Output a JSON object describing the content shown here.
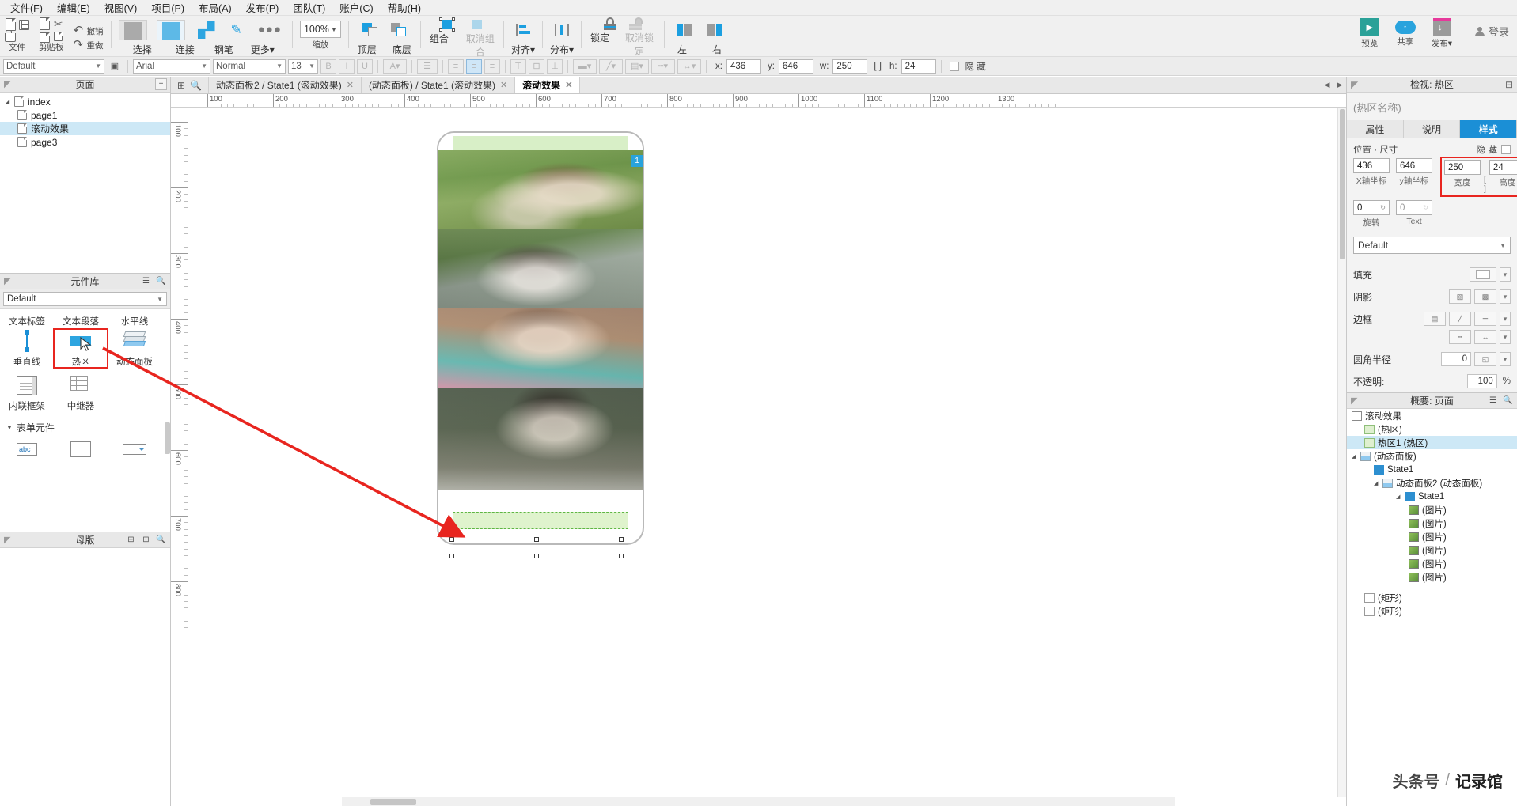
{
  "menu": {
    "items": [
      "文件(F)",
      "编辑(E)",
      "视图(V)",
      "项目(P)",
      "布局(A)",
      "发布(P)",
      "团队(T)",
      "账户(C)",
      "帮助(H)"
    ]
  },
  "ribbon": {
    "groups": [
      {
        "label": "文件"
      },
      {
        "label": "剪贴板"
      }
    ],
    "undo": "撤销",
    "redo": "重做",
    "tools": [
      {
        "label": "选择",
        "icon": "select-icon"
      },
      {
        "label": "连接",
        "icon": "connect-icon"
      },
      {
        "label": "钢笔",
        "icon": "pen-icon"
      },
      {
        "label": "更多",
        "icon": "more-icon"
      }
    ],
    "zoom": {
      "value": "100%",
      "label": "缩放"
    },
    "arrange": [
      {
        "label": "顶层",
        "icon": "bring-front-icon"
      },
      {
        "label": "底层",
        "icon": "send-back-icon"
      },
      {
        "label": "组合",
        "icon": "group-icon"
      },
      {
        "label": "取消组合",
        "icon": "ungroup-icon"
      },
      {
        "label": "对齐",
        "icon": "align-icon"
      },
      {
        "label": "分布",
        "icon": "distribute-icon"
      },
      {
        "label": "锁定",
        "icon": "lock-icon"
      },
      {
        "label": "取消锁定",
        "icon": "unlock-icon"
      },
      {
        "label": "左",
        "icon": "align-left-icon"
      },
      {
        "label": "右",
        "icon": "align-right-icon"
      }
    ],
    "right_actions": [
      {
        "label": "预览",
        "icon": "preview-icon"
      },
      {
        "label": "共享",
        "icon": "share-icon"
      },
      {
        "label": "发布",
        "icon": "publish-icon"
      }
    ],
    "login": "登录"
  },
  "stylebar": {
    "style_value": "Default",
    "font_value": "Arial",
    "weight_value": "Normal",
    "size_value": "13",
    "bold": "B",
    "italic": "I",
    "underline": "U",
    "x_label": "x:",
    "x_value": "436",
    "y_label": "y:",
    "y_value": "646",
    "w_label": "w:",
    "w_value": "250",
    "h_label": "h:",
    "h_value": "24",
    "hidden_label": "隐 藏"
  },
  "pages_panel": {
    "title": "页面",
    "add_icon": "add-page-icon",
    "items": [
      {
        "label": "index",
        "level": 0,
        "expandable": true,
        "selected": false
      },
      {
        "label": "page1",
        "level": 1,
        "expandable": false,
        "selected": false
      },
      {
        "label": "滚动效果",
        "level": 1,
        "expandable": false,
        "selected": true
      },
      {
        "label": "page3",
        "level": 1,
        "expandable": false,
        "selected": false
      }
    ]
  },
  "widget_library": {
    "title": "元件库",
    "menu_icon": "hamburger-icon",
    "search_icon": "search-icon",
    "combo_value": "Default",
    "widgets": [
      {
        "label": "文本标签",
        "icon": "text-label-icon",
        "highlighted": false
      },
      {
        "label": "文本段落",
        "icon": "text-paragraph-icon",
        "highlighted": false
      },
      {
        "label": "水平线",
        "icon": "horizontal-line-icon",
        "highlighted": false
      },
      {
        "label": "垂直线",
        "icon": "vertical-line-icon",
        "highlighted": false
      },
      {
        "label": "热区",
        "icon": "hotspot-icon",
        "highlighted": true
      },
      {
        "label": "动态面板",
        "icon": "dynamic-panel-icon",
        "highlighted": false
      },
      {
        "label": "内联框架",
        "icon": "inline-frame-icon",
        "highlighted": false
      },
      {
        "label": "中继器",
        "icon": "repeater-icon",
        "highlighted": false
      }
    ],
    "form_section": "表单元件"
  },
  "masters_panel": {
    "title": "母版"
  },
  "tabs": [
    {
      "label": "动态面板2 / State1 (滚动效果)",
      "active": false,
      "closable": true
    },
    {
      "label": "(动态面板) / State1 (滚动效果)",
      "active": false,
      "closable": true
    },
    {
      "label": "滚动效果",
      "active": true,
      "closable": true
    }
  ],
  "canvas": {
    "ruler_h": [
      "100",
      "200",
      "300",
      "400",
      "500",
      "600",
      "700",
      "800",
      "900",
      "1000",
      "1100",
      "1200",
      "1300"
    ],
    "ruler_v": [
      "100",
      "200",
      "300",
      "400",
      "500",
      "600",
      "700",
      "800"
    ],
    "badge_number": "1",
    "photos": [
      {
        "name": "photo-girl-grass"
      },
      {
        "name": "photo-girl-greenery"
      },
      {
        "name": "photo-girl-glasses"
      },
      {
        "name": "photo-girl-standing"
      }
    ]
  },
  "inspector": {
    "header": "检视: 热区",
    "title": "(热区名称)",
    "tabs": [
      {
        "label": "属性",
        "active": false
      },
      {
        "label": "说明",
        "active": false
      },
      {
        "label": "样式",
        "active": true
      }
    ],
    "position_size_label": "位置 · 尺寸",
    "hidden_label": "隐 藏",
    "x_value": "436",
    "x_caption": "X轴坐标",
    "y_value": "646",
    "y_caption": "y轴坐标",
    "w_value": "250",
    "w_caption": "宽度",
    "h_value": "24",
    "h_caption": "高度",
    "lock_icon": "link-ratio-icon",
    "rotate_value": "0",
    "rotate_caption": "旋转",
    "text_rotate_value": "0",
    "text_caption": "Text",
    "style_dropdown": "Default",
    "fill_label": "填充",
    "shadow_label": "阴影",
    "border_label": "边框",
    "corner_label": "圆角半径",
    "corner_value": "0",
    "opacity_label": "不透明:",
    "opacity_value": "100",
    "opacity_unit": "%",
    "highlight_color": "#e8251f"
  },
  "outline": {
    "title": "概要: 页面",
    "root": "滚动效果",
    "rows": [
      {
        "label": "(热区)",
        "indent": 1,
        "icon": "hotspot-icon",
        "selected": false,
        "caret": false
      },
      {
        "label": "热区1 (热区)",
        "indent": 1,
        "icon": "hotspot-icon",
        "selected": true,
        "caret": false
      },
      {
        "label": "(动态面板)",
        "indent": 1,
        "icon": "dynamic-panel-icon",
        "selected": false,
        "caret": true
      },
      {
        "label": "State1",
        "indent": 2,
        "icon": "state-icon",
        "selected": false,
        "caret": false
      },
      {
        "label": "动态面板2 (动态面板)",
        "indent": 3,
        "icon": "dynamic-panel-icon",
        "selected": false,
        "caret": true
      },
      {
        "label": "State1",
        "indent": 4,
        "icon": "state-icon",
        "selected": false,
        "caret": true
      },
      {
        "label": "(图片)",
        "indent": 5,
        "icon": "image-icon",
        "selected": false,
        "caret": false
      },
      {
        "label": "(图片)",
        "indent": 5,
        "icon": "image-icon",
        "selected": false,
        "caret": false
      },
      {
        "label": "(图片)",
        "indent": 5,
        "icon": "image-icon",
        "selected": false,
        "caret": false
      },
      {
        "label": "(图片)",
        "indent": 5,
        "icon": "image-icon",
        "selected": false,
        "caret": false
      },
      {
        "label": "(图片)",
        "indent": 5,
        "icon": "image-icon",
        "selected": false,
        "caret": false
      },
      {
        "label": "(图片)",
        "indent": 5,
        "icon": "image-icon",
        "selected": false,
        "caret": false
      },
      {
        "label": "(矩形)",
        "indent": 1,
        "icon": "rect-icon",
        "selected": false,
        "caret": false
      },
      {
        "label": "(矩形)",
        "indent": 1,
        "icon": "rect-icon",
        "selected": false,
        "caret": false
      }
    ]
  },
  "watermark": {
    "left": "头条号",
    "sep": "/",
    "right": "记录馆"
  }
}
